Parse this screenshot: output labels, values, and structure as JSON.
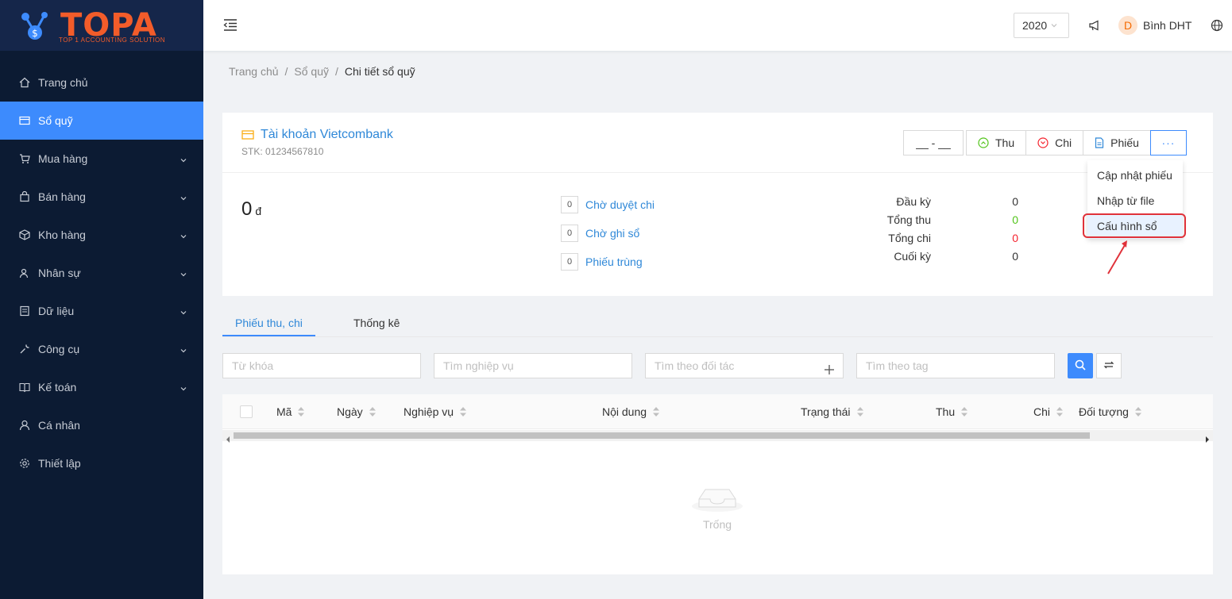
{
  "brand": {
    "logo_text": "TOPA",
    "tagline": "TOP 1 ACCOUNTING SOLUTION"
  },
  "sidebar": {
    "items": [
      {
        "label": "Trang chủ",
        "icon": "home-icon",
        "active": false,
        "expandable": false
      },
      {
        "label": "Sổ quỹ",
        "icon": "wallet-icon",
        "active": true,
        "expandable": false
      },
      {
        "label": "Mua hàng",
        "icon": "cart-icon",
        "active": false,
        "expandable": true
      },
      {
        "label": "Bán hàng",
        "icon": "shopping-bag-icon",
        "active": false,
        "expandable": true
      },
      {
        "label": "Kho hàng",
        "icon": "box-icon",
        "active": false,
        "expandable": true
      },
      {
        "label": "Nhân sự",
        "icon": "team-icon",
        "active": false,
        "expandable": true
      },
      {
        "label": "Dữ liệu",
        "icon": "database-icon",
        "active": false,
        "expandable": true
      },
      {
        "label": "Công cụ",
        "icon": "tool-icon",
        "active": false,
        "expandable": true
      },
      {
        "label": "Kế toán",
        "icon": "book-icon",
        "active": false,
        "expandable": true
      },
      {
        "label": "Cá nhân",
        "icon": "user-icon",
        "active": false,
        "expandable": false
      },
      {
        "label": "Thiết lập",
        "icon": "settings-icon",
        "active": false,
        "expandable": false
      }
    ]
  },
  "header": {
    "year": "2020",
    "avatar_letter": "D",
    "username": "Bình DHT"
  },
  "breadcrumb": {
    "home": "Trang chủ",
    "section": "Sổ quỹ",
    "current": "Chi tiết sổ quỹ"
  },
  "account": {
    "name": "Tài khoản Vietcombank",
    "number": "STK: 01234567810",
    "date_range": "__ - __",
    "balance": "0",
    "currency": "đ"
  },
  "actions": {
    "thu": "Thu",
    "chi": "Chi",
    "phieu": "Phiếu",
    "more": "···"
  },
  "dropdown": {
    "items": [
      "Cập nhật phiếu",
      "Nhập từ file",
      "Cấu hình sổ"
    ],
    "highlighted": "Cấu hình sổ"
  },
  "status": [
    {
      "count": "0",
      "label": "Chờ duyệt chi"
    },
    {
      "count": "0",
      "label": "Chờ ghi sổ"
    },
    {
      "count": "0",
      "label": "Phiếu trùng"
    }
  ],
  "summary": [
    {
      "label": "Đầu kỳ",
      "value": "0",
      "color": "#333333"
    },
    {
      "label": "Tổng thu",
      "value": "0",
      "color": "#52c41a"
    },
    {
      "label": "Tổng chi",
      "value": "0",
      "color": "#f5222d"
    },
    {
      "label": "Cuối kỳ",
      "value": "0",
      "color": "#333333"
    }
  ],
  "tabs": [
    "Phiếu thu, chi",
    "Thống kê"
  ],
  "filters": {
    "keyword": "Từ khóa",
    "operation": "Tìm nghiệp vụ",
    "partner": "Tìm theo đối tác",
    "tag": "Tìm theo tag"
  },
  "table": {
    "columns": [
      "Mã",
      "Ngày",
      "Nghiệp vụ",
      "Nội dung",
      "Trạng thái",
      "Thu",
      "Chi",
      "Đối tượng"
    ],
    "empty_text": "Trống"
  },
  "colors": {
    "sidebar_bg": "#0c1b33",
    "accent": "#3d8bfd",
    "link": "#2f88d8",
    "brand": "#f25c2a"
  }
}
